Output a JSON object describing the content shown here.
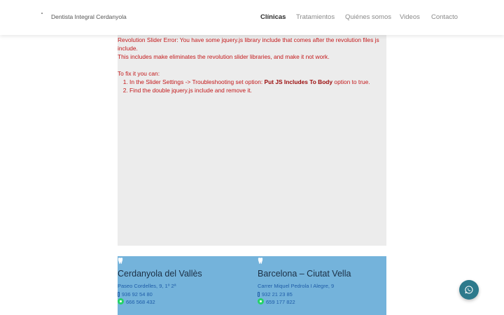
{
  "header": {
    "brand": "Dentista Integral Cerdanyola",
    "nav": [
      {
        "label": "Clínicas",
        "active": true
      },
      {
        "label": "Tratamientos",
        "active": false
      },
      {
        "label": "Quiénes somos",
        "active": false
      },
      {
        "label": "Videos",
        "active": false
      },
      {
        "label": "Contacto",
        "active": false
      }
    ]
  },
  "slider_error": {
    "line1": "Revolution Slider Error: You have some jquery.js library include that comes after the revolution files js include.",
    "line2": "This includes make eliminates the revolution slider libraries, and make it not work.",
    "fix_intro": "To fix it you can:",
    "steps": [
      {
        "before": "In the Slider Settings -> Troubleshooting set option: ",
        "bold": "Put JS Includes To Body",
        "after": " option to true."
      },
      {
        "text": "Find the double jquery.js include and remove it."
      }
    ]
  },
  "locations": [
    {
      "icon": "tooth-icon",
      "city": "Cerdanyola del Vallès",
      "address": "Paseo Cordelles, 9, 1º 2ª",
      "phone": "936 92 54 80",
      "whatsapp": "666 568 432"
    },
    {
      "icon": "tooth-icon",
      "city": "Barcelona – Ciutat Vella",
      "address": "Carrer Miquel Pedrola I Alegre, 9",
      "phone": "932 21 23 85",
      "whatsapp": "659 177 822"
    }
  ],
  "colors": {
    "error_text": "#c3181a",
    "footer_band": "#74b3db",
    "fab": "#2d7a8c",
    "whatsapp_green": "#25d366"
  }
}
